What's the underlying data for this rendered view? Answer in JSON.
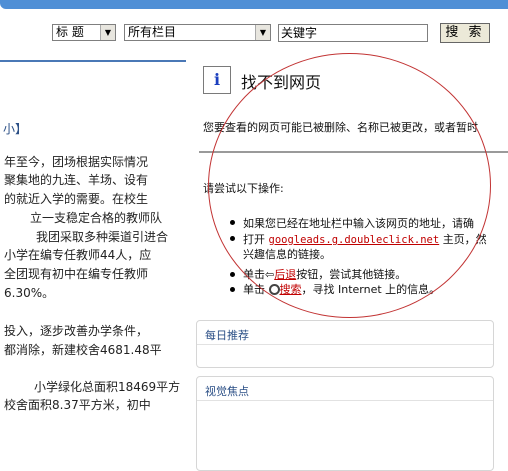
{
  "search": {
    "field_select": "标 题",
    "column_select": "所有栏目",
    "keyword_value": "关键字",
    "search_button": "搜 索"
  },
  "left": {
    "snippet": "小】",
    "lines": [
      "年至今，团场根据实际情况",
      "聚集地的九连、羊场、设有",
      "的就近入学的需要。在校生",
      "立一支稳定合格的教师队",
      "我团采取多种渠道引进合",
      "小学在编专任教师44人，应",
      "全团现有初中在编专任教师",
      "6.30%。",
      "投入，逐步改善办学条件，",
      "都消除，新建校舍4681.48平",
      "小学绿化总面积18469平方",
      "校舍面积8.37平方米，初中"
    ]
  },
  "error": {
    "title": "找不到网页",
    "message": "您要查看的网页可能已被删除、名称已被更改，或者暂时",
    "try_heading": "请尝试以下操作:",
    "bullet1_text": "如果您已经在地址栏中输入该网页的地址，请确",
    "bullet2_prefix": "打开",
    "bullet2_link": "googleads.g.doubleclick.net",
    "bullet2_suffix": "主页，然",
    "bullet2_line2": "兴趣信息的链接。",
    "bullet3_prefix": "单击",
    "bullet3_link": "后退",
    "bullet3_suffix": "按钮，尝试其他链接。",
    "bullet4_prefix": "单击",
    "bullet4_link": "搜索",
    "bullet4_suffix": "，寻找 Internet 上的信息。"
  },
  "panels": {
    "daily": "每日推荐",
    "focus": "视觉焦点"
  },
  "colors": {
    "accent_bar": "#4f8fd6",
    "link": "#c00000",
    "annotation_circle": "#c23434",
    "panel_heading": "#2b4f86"
  }
}
